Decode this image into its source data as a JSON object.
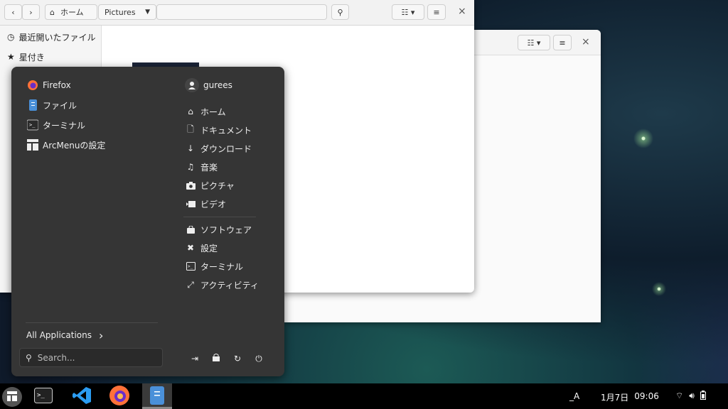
{
  "file_window": {
    "home_label": "ホーム",
    "current_folder": "Pictures",
    "sidebar": [
      {
        "label": "最近開いたファイル",
        "icon": "clock-icon"
      },
      {
        "label": "星付き",
        "icon": "star-icon"
      }
    ]
  },
  "menu": {
    "apps": [
      {
        "label": "Firefox",
        "icon": "firefox-icon"
      },
      {
        "label": "ファイル",
        "icon": "files-icon"
      },
      {
        "label": "ターミナル",
        "icon": "terminal-icon"
      },
      {
        "label": "ArcMenuの設定",
        "icon": "arcmenu-settings-icon"
      }
    ],
    "user": "gurees",
    "places": [
      {
        "label": "ホーム",
        "icon": "home-icon"
      },
      {
        "label": "ドキュメント",
        "icon": "document-icon"
      },
      {
        "label": "ダウンロード",
        "icon": "download-icon"
      },
      {
        "label": "音楽",
        "icon": "music-icon"
      },
      {
        "label": "ピクチャ",
        "icon": "camera-icon"
      },
      {
        "label": "ビデオ",
        "icon": "video-icon"
      }
    ],
    "system": [
      {
        "label": "ソフトウェア",
        "icon": "software-bag-icon"
      },
      {
        "label": "設定",
        "icon": "settings-tools-icon"
      },
      {
        "label": "ターミナル",
        "icon": "terminal-icon"
      },
      {
        "label": "アクティビティ",
        "icon": "activities-icon"
      }
    ],
    "all_apps_label": "All Applications",
    "search_placeholder": "Search...",
    "power_buttons": [
      "logout-icon",
      "lock-icon",
      "restart-icon",
      "power-icon"
    ]
  },
  "taskbar": {
    "apps": [
      "terminal-icon",
      "vscode-icon",
      "firefox-icon",
      "files-icon"
    ],
    "input_method": "_A",
    "date": "1月7日",
    "time": "09:06",
    "tray": [
      "wifi-icon",
      "volume-icon",
      "battery-icon"
    ]
  }
}
